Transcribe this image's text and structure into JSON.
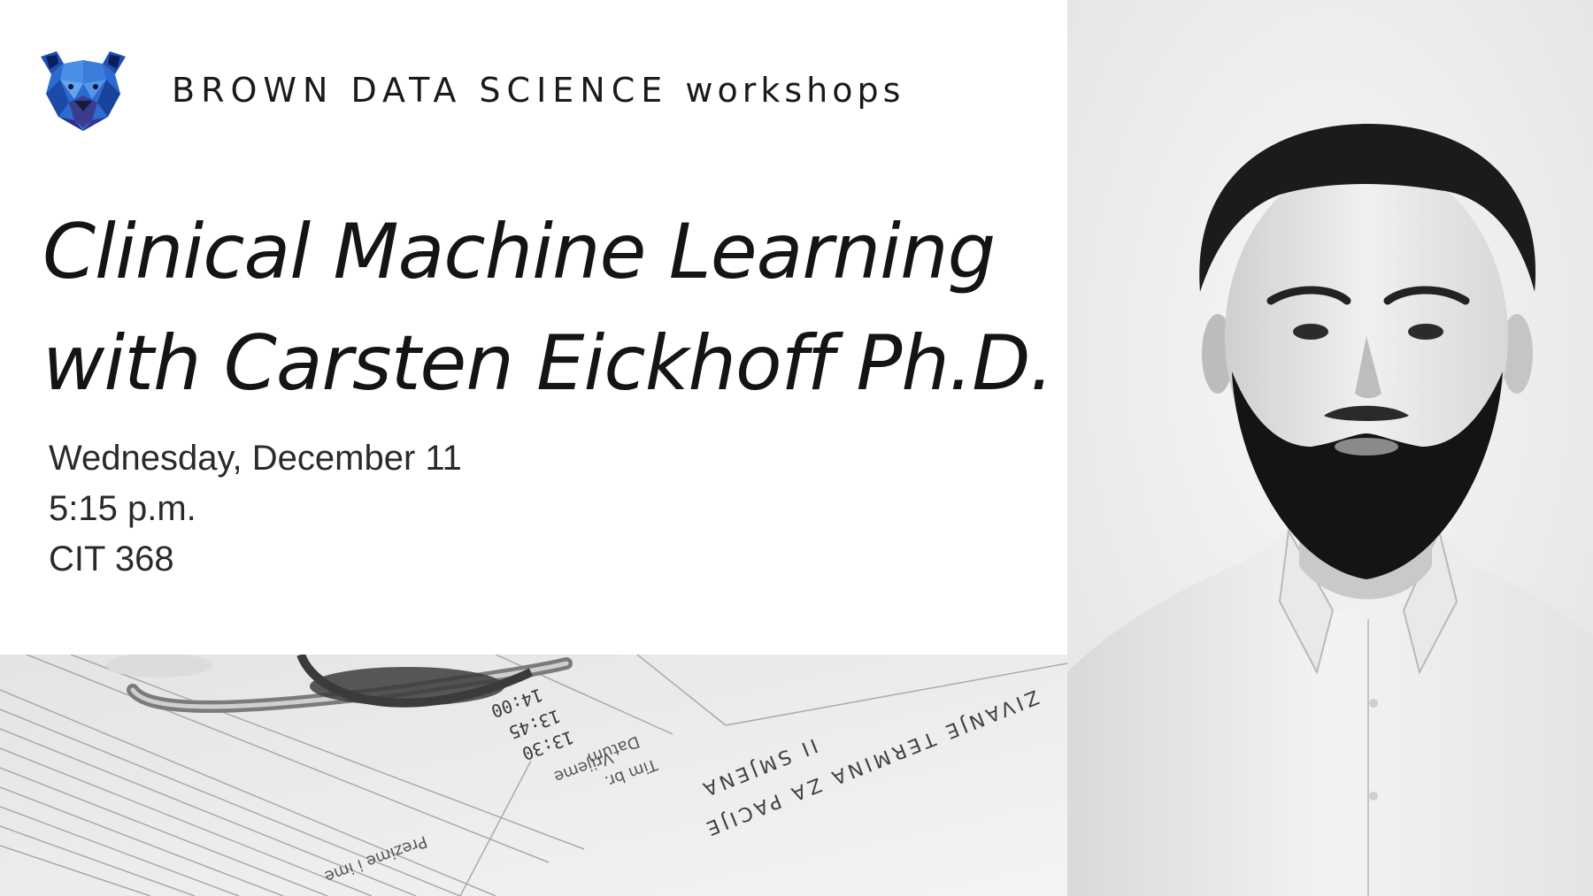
{
  "header": {
    "org_caps": "BROWN DATA SCIENCE",
    "org_suffix": "workshops"
  },
  "event": {
    "title_line1": "Clinical Machine Learning",
    "title_line2": "with Carsten Eickhoff Ph.D.",
    "date": "Wednesday, December 11",
    "time": "5:15 p.m.",
    "location": "CIT 368"
  },
  "document_photo": {
    "times": [
      "14:00",
      "13:45",
      "13:30"
    ],
    "labels": [
      "Vrijeme",
      "Datum",
      "Tim br."
    ],
    "heading": "ZIVANJE TERMINA ZA PACIJE",
    "shift": "II SMJENA",
    "column": "Prezime i ime"
  },
  "colors": {
    "logo_blue": "#2f6fd3",
    "logo_dark": "#10256b",
    "text": "#1a1a1a"
  }
}
